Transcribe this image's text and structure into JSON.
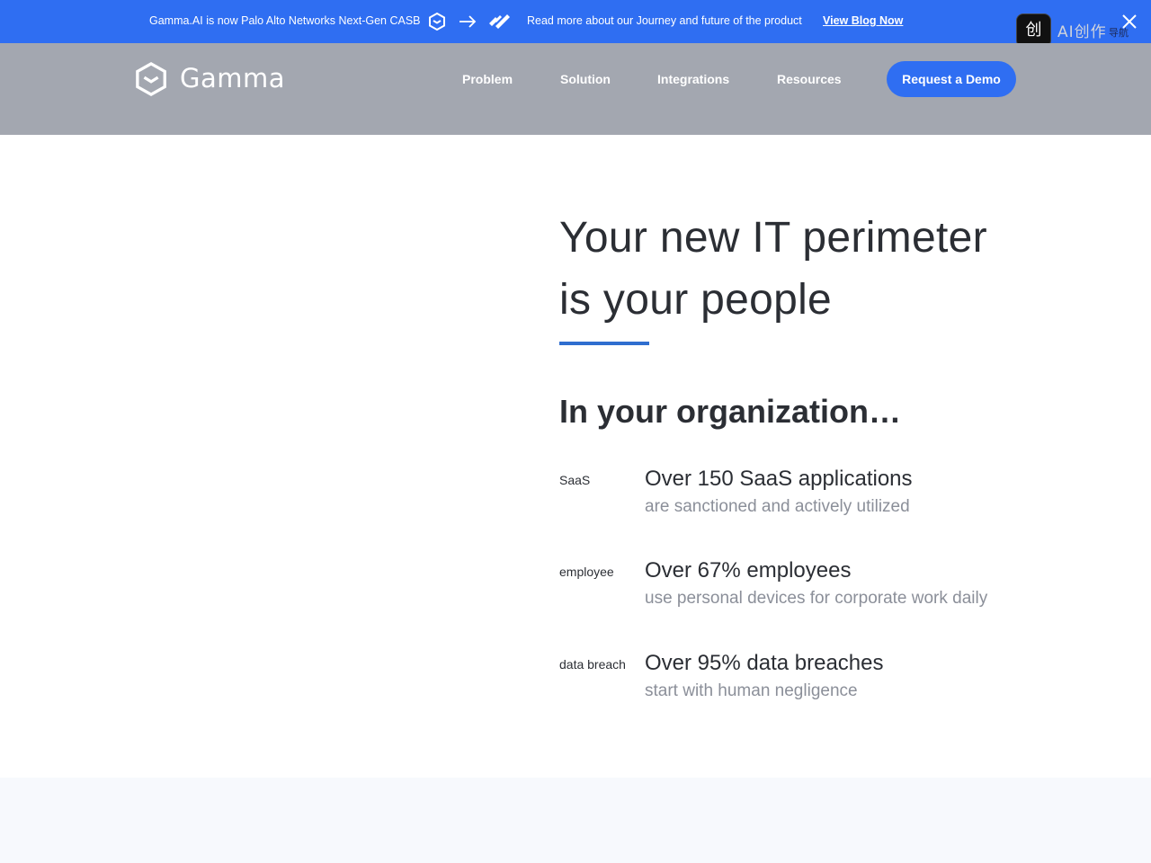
{
  "announcement": {
    "message": "Gamma.AI is now Palo Alto Networks Next-Gen CASB",
    "read_more": "Read more about our Journey and future of the product",
    "blog_link": "View Blog Now"
  },
  "extension": {
    "badge": "创",
    "label": "AI创作",
    "sub": "导航"
  },
  "header": {
    "logo_text": "Gamma",
    "nav": [
      "Problem",
      "Solution",
      "Integrations",
      "Resources"
    ],
    "cta": "Request a Demo"
  },
  "hero": {
    "title_line1": "Your new IT perimeter",
    "title_line2": "is your people",
    "org_heading": "In your organization…",
    "stats": [
      {
        "img_alt": "SaaS",
        "headline": "Over 150 SaaS applications",
        "sub": "are sanctioned and actively utilized"
      },
      {
        "img_alt": "employee",
        "headline": "Over 67% employees",
        "sub": "use personal devices for corporate work daily"
      },
      {
        "img_alt": "data breach",
        "headline": "Over 95% data breaches",
        "sub": "start with human negligence"
      }
    ]
  },
  "colors": {
    "brand_blue": "#2f6ef2",
    "nav_bg": "#a3a7b0",
    "accent_line": "#2f6ecf",
    "muted_text": "#8b8f99"
  }
}
